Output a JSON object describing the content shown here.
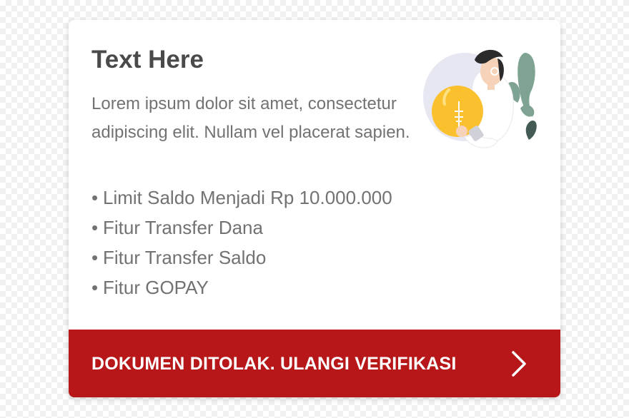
{
  "card": {
    "title": "Text Here",
    "description": "Lorem ipsum dolor sit amet, consectetur adipiscing elit. Nullam vel placerat sapien.",
    "features": [
      "Limit Saldo Menjadi Rp 10.000.000",
      "Fitur Transfer Dana",
      "Fitur Transfer Saldo",
      "Fitur GOPAY"
    ],
    "bullet": "•",
    "illustration": "person-holding-lightbulb-illustration",
    "cta": {
      "label": "DOKUMEN DITOLAK. ULANGI VERIFIKASI",
      "icon": "chevron-right-icon"
    }
  },
  "colors": {
    "cta_background": "#b8171a",
    "title_text": "#4a4a4a",
    "body_text": "#727272",
    "bulb_yellow": "#fbc02d",
    "plant_green": "#7fa393"
  }
}
